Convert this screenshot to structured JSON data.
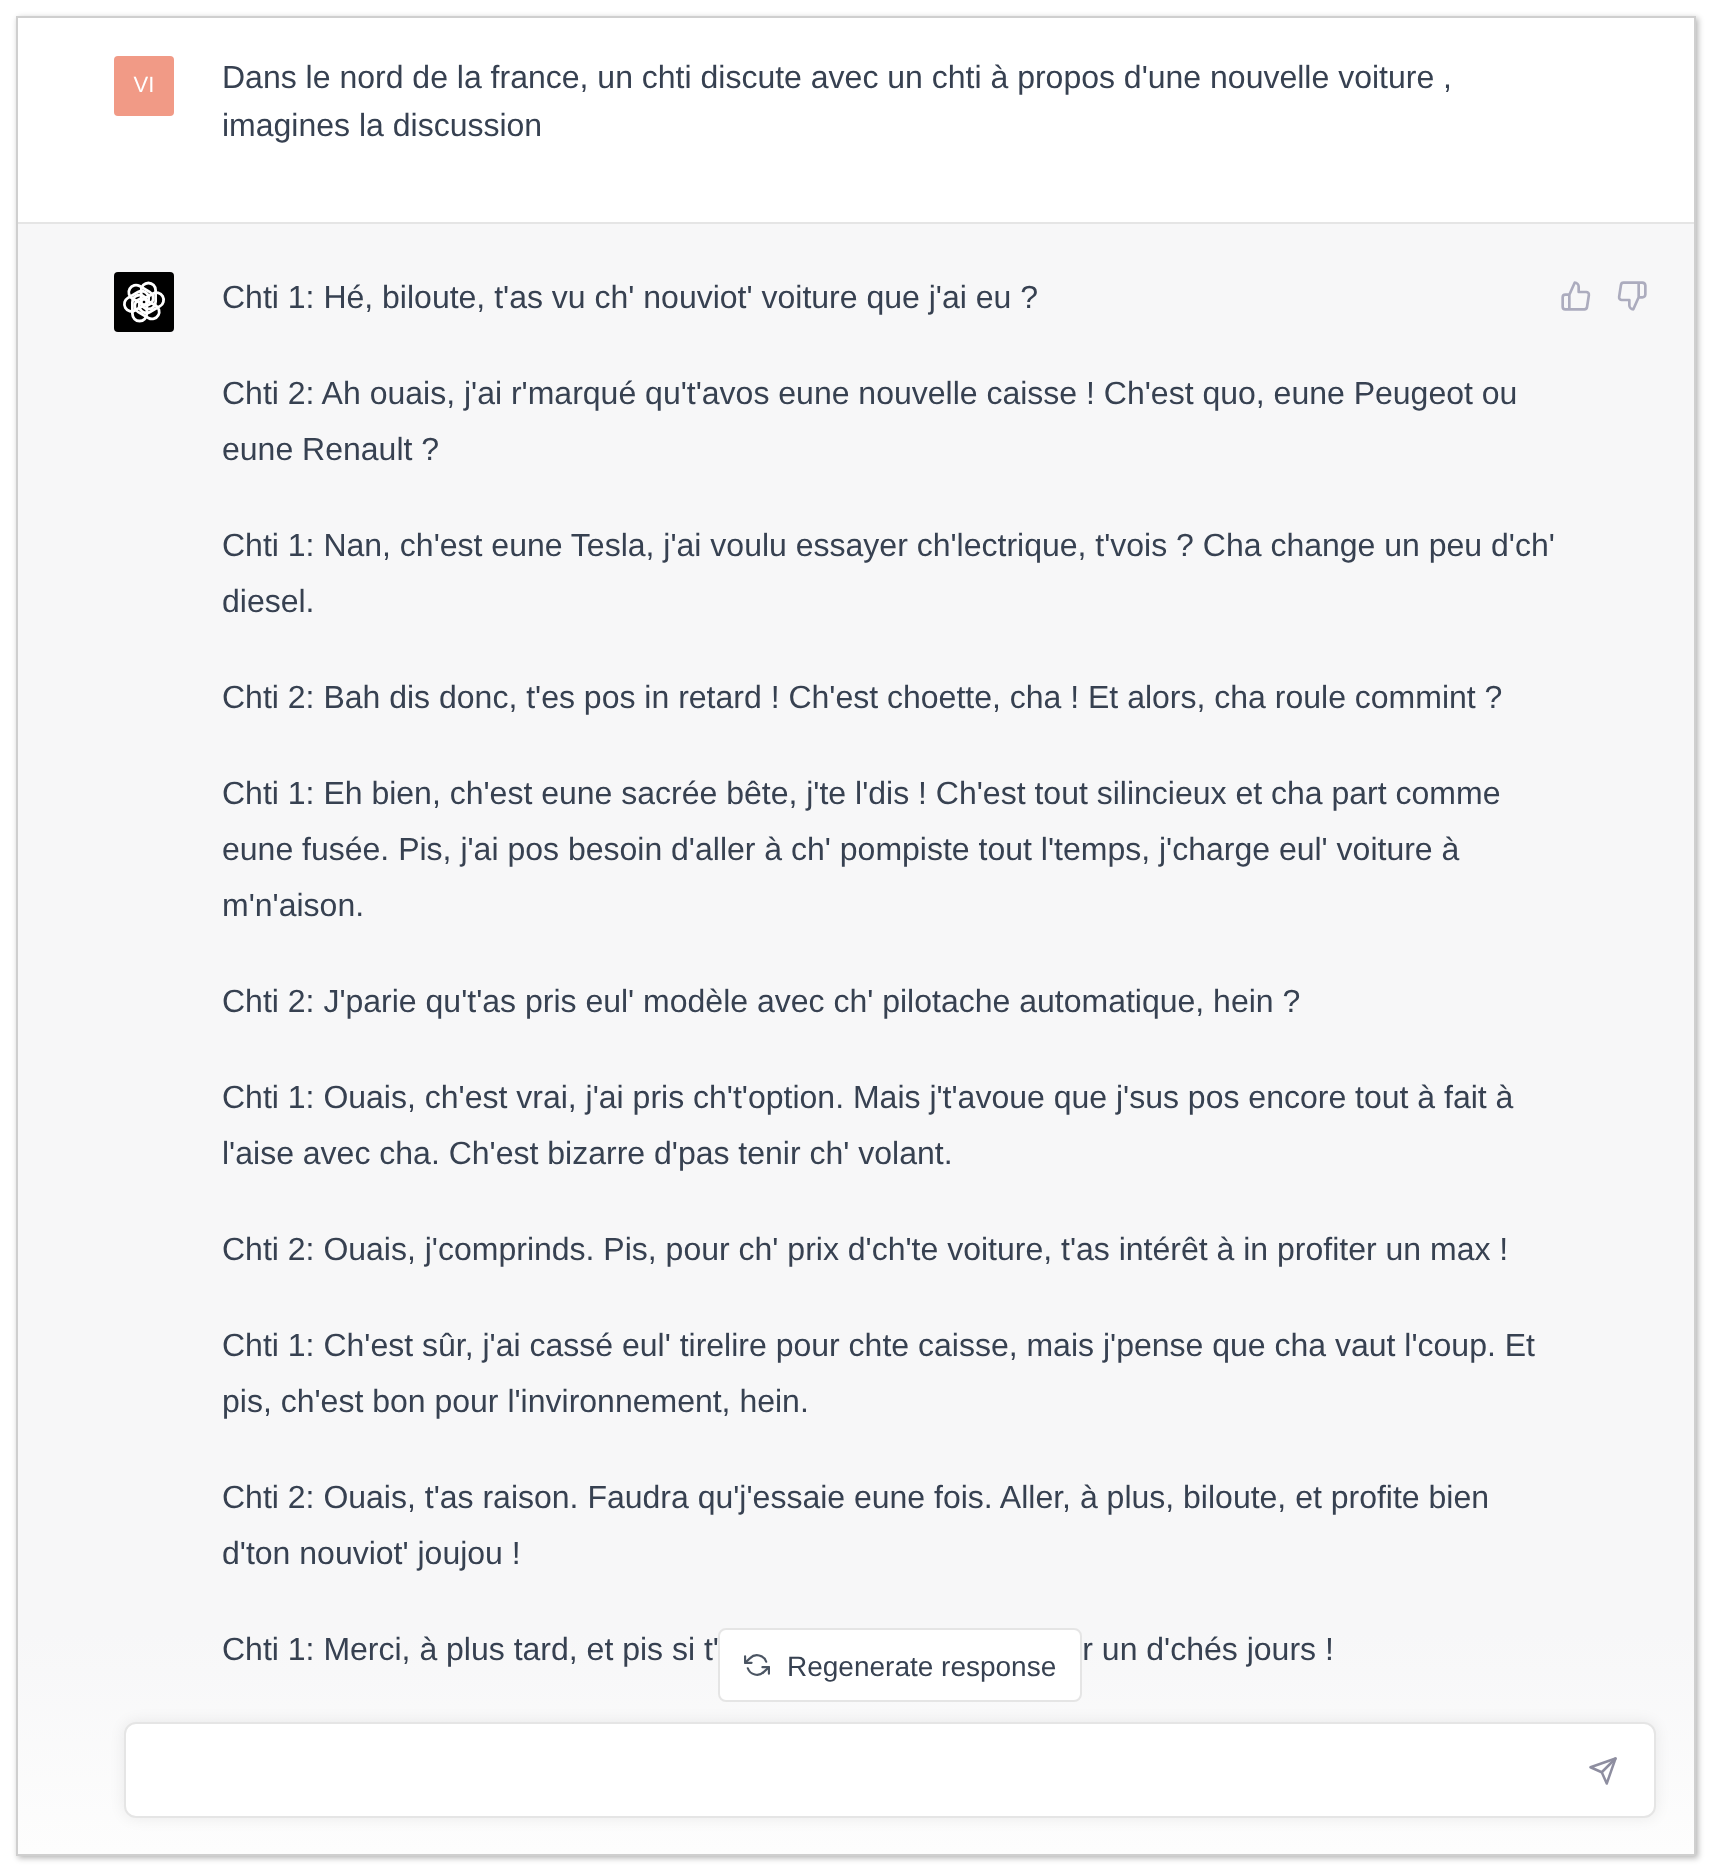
{
  "prompt": {
    "avatar_initials": "VI",
    "text": "Dans le nord de la france, un chti discute avec un chti à propos d'une nouvelle voiture , imagines la discussion"
  },
  "answer": {
    "paragraphs": [
      "Chti 1: Hé, biloute, t'as vu ch' nouviot' voiture que j'ai eu ?",
      "Chti 2: Ah ouais, j'ai r'marqué qu't'avos eune nouvelle caisse ! Ch'est quo, eune Peugeot ou eune Renault ?",
      "Chti 1: Nan, ch'est eune Tesla, j'ai voulu essayer ch'lectrique, t'vois ? Cha change un peu d'ch' diesel.",
      "Chti 2: Bah dis donc, t'es pos in retard ! Ch'est choette, cha ! Et alors, cha roule commint ?",
      "Chti 1: Eh bien, ch'est eune sacrée bête, j'te l'dis ! Ch'est tout silincieux et cha part comme eune fusée. Pis, j'ai pos besoin d'aller à ch' pompiste tout l'temps, j'charge eul' voiture à m'n'aison.",
      "Chti 2: J'parie qu't'as pris eul' modèle avec ch' pilotache automatique, hein ?",
      "Chti 1: Ouais, ch'est vrai, j'ai pris ch't'option. Mais j't'avoue que j'sus pos encore tout à fait à l'aise avec cha. Ch'est bizarre d'pas tenir ch' volant.",
      "Chti 2: Ouais, j'comprinds. Pis, pour ch' prix d'ch'te voiture, t'as intérêt à in profiter un max !",
      "Chti 1: Ch'est sûr, j'ai cassé eul' tirelire pour chte caisse, mais j'pense que cha vaut l'coup. Et pis, ch'est bon pour l'invironnement, hein.",
      "Chti 2: Ouais, t'as raison. Faudra qu'j'essaie eune fois. Aller, à plus, biloute, et profite bien d'ton nouviot' joujou !"
    ],
    "last_line": {
      "text_before": "Chti 1: Merci, à plus tard, et pis si t'",
      "regenerate_button": "Regenerate response",
      "text_after": "r un d'chés jours !"
    }
  }
}
